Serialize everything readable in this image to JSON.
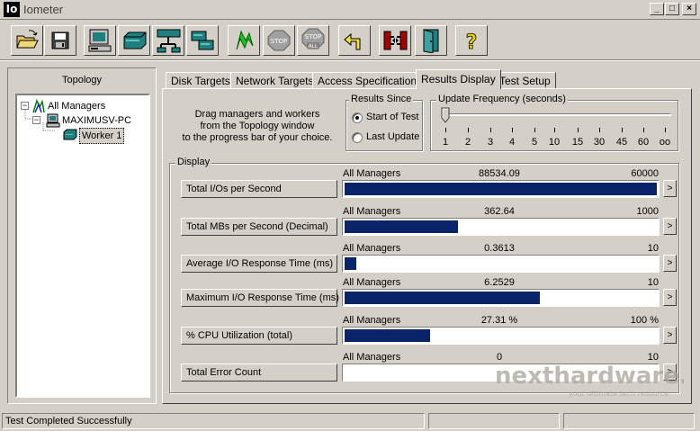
{
  "window": {
    "title": "Iometer",
    "icon_text": "Io"
  },
  "toolbar": {
    "buttons": [
      "open-config",
      "save-config",
      "new-manager",
      "new-disk-worker",
      "new-network-worker",
      "duplicate-worker",
      "start-tests",
      "stop-test",
      "stop-all",
      "reset-workers",
      "disconnect",
      "exit",
      "about"
    ]
  },
  "topology": {
    "title": "Topology",
    "nodes": [
      {
        "label": "All Managers",
        "expander": "−"
      },
      {
        "label": "MAXIMUSV-PC",
        "expander": "−"
      },
      {
        "label": "Worker 1"
      }
    ]
  },
  "tabs": [
    {
      "label": "Disk Targets"
    },
    {
      "label": "Network Targets"
    },
    {
      "label": "Access Specifications"
    },
    {
      "label": "Results Display"
    },
    {
      "label": "Test Setup"
    }
  ],
  "instructions": {
    "line1": "Drag managers and workers",
    "line2": "from the Topology window",
    "line3": "to the progress bar of your choice."
  },
  "results_since": {
    "title": "Results Since",
    "options": [
      {
        "label": "Start of Test",
        "selected": true
      },
      {
        "label": "Last Update",
        "selected": false
      }
    ]
  },
  "update_frequency": {
    "title": "Update Frequency (seconds)",
    "ticks": [
      "1",
      "2",
      "3",
      "4",
      "5",
      "10",
      "15",
      "30",
      "45",
      "60",
      "oo"
    ],
    "selected_index": 0
  },
  "display": {
    "title": "Display",
    "accent_color": "#0a246a",
    "metrics": [
      {
        "label": "Total I/Os per Second",
        "source": "All Managers",
        "value": "88534.09",
        "max": "60000",
        "fill": 1.0
      },
      {
        "label": "Total MBs per Second (Decimal)",
        "source": "All Managers",
        "value": "362.64",
        "max": "1000",
        "fill": 0.3626
      },
      {
        "label": "Average I/O Response Time (ms)",
        "source": "All Managers",
        "value": "0.3613",
        "max": "10",
        "fill": 0.0361
      },
      {
        "label": "Maximum I/O Response Time (ms)",
        "source": "All Managers",
        "value": "6.2529",
        "max": "10",
        "fill": 0.6253
      },
      {
        "label": "% CPU Utilization (total)",
        "source": "All Managers",
        "value": "27.31 %",
        "max": "100 %",
        "fill": 0.2731
      },
      {
        "label": "Total Error Count",
        "source": "All Managers",
        "value": "0",
        "max": "10",
        "fill": 0.0
      }
    ],
    "arrow": ">"
  },
  "status": {
    "text": "Test Completed Successfully"
  },
  "watermark": {
    "main": "nexthardware.com",
    "sub": "your ultimate tech resource"
  },
  "win_buttons": {
    "minimize": "_",
    "maximize": "□",
    "close": "×"
  }
}
